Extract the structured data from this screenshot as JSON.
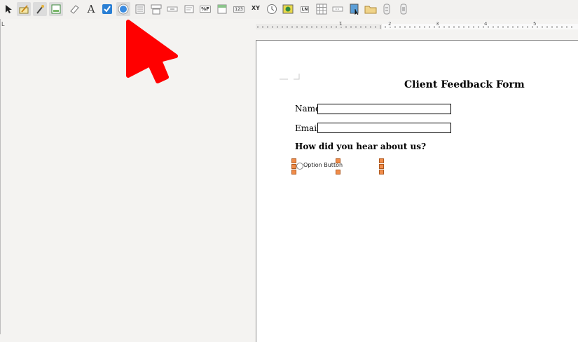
{
  "toolbar": {
    "icons": [
      "select-icon",
      "design-mode-icon",
      "control-wizard-icon",
      "form-design-icon",
      "tab-order-icon",
      "label-icon",
      "checkbox-icon",
      "option-button-icon",
      "list-box-icon",
      "combo-box-icon",
      "push-button-icon",
      "text-box-icon",
      "formatted-field-icon",
      "group-box-icon",
      "numeric-field-icon",
      "xy-chart-icon",
      "time-field-icon",
      "image-button-icon",
      "line-numbering-icon",
      "table-control-icon",
      "navigation-bar-icon",
      "image-control-icon",
      "folder-icon",
      "spin-button-icon",
      "scrollbar-icon"
    ],
    "formatted_field_text": "%F",
    "numeric_field_text": "123",
    "xy_text": "XY",
    "ln_text": "LN",
    "label_text": "A"
  },
  "ruler": {
    "numbers": [
      "1",
      "2",
      "3",
      "4",
      "5"
    ],
    "corner_mark": "L"
  },
  "document": {
    "title": "Client Feedback Form",
    "name_label": "Name:",
    "email_label": "Email:",
    "question": "How did you hear about us?",
    "option_label": "Option Button"
  },
  "colors": {
    "pointer_arrow": "#ff0000",
    "selection_handle": "#f08c4a",
    "checkbox_blue": "#2a7fd4"
  }
}
